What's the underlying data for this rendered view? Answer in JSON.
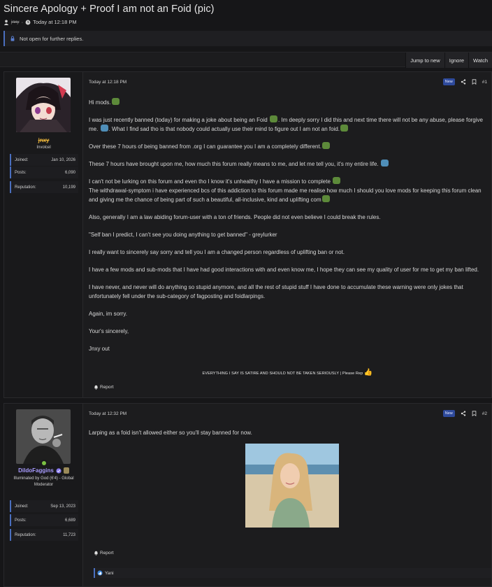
{
  "thread": {
    "title": "Sincere Apology + Proof I am not an Foid (pic)",
    "author": "jnxy",
    "date": "Today at 12:18 PM",
    "notice": "Not open for further replies."
  },
  "actions": {
    "jump_to_new": "Jump to new",
    "ignore": "Ignore",
    "watch": "Watch"
  },
  "posts": [
    {
      "username": "jnxy",
      "user_title": "Involcel",
      "joined_label": "Joined:",
      "joined": "Jan 10, 2026",
      "posts_label": "Posts:",
      "posts": "6,090",
      "reputation_label": "Reputation:",
      "reputation": "10,199",
      "date": "Today at 12:18 PM",
      "badge": "New",
      "number": "#1",
      "paragraphs": [
        "Hi mods.",
        "I was just recently banned (today) for making a joke about being an Foid",
        ". Im deeply sorry I did this and next time there will not be any abuse, please forgive me.",
        ". What I find sad tho is that nobody could actually use their mind to figure out I am not an foid.",
        "Over these 7 hours of being banned from .org I can guarantee you I am a completely different.",
        "These 7 hours have brought upon me, how much this forum really means to me, and let me tell you, it's my entire life.",
        "I can't not be lurking on this forum and even tho I know it's unhealthy I have a mission to complete",
        "The withdrawal-symptom i have experienced bcs of this addiction to this forum made me realise how much I should you love mods for keeping this forum clean and giving me the chance of being part of such a beautiful, all-inclusive, kind and uplifting com",
        "Also, generally I am a law abiding forum-user with a ton of friends. People did not even believe I could break the rules.",
        "\"Self ban I predict, I can't see you doing anything to get banned\" - greylurker",
        "I really want to sincerely say sorry and tell you I am a changed person regardless of uplifting ban or not.",
        "I have a few mods and sub-mods that I have had good interactions with and even know me, I hope they can see my quality of user for me to get my ban lifted.",
        "I have never, and never will do anything so stupid anymore, and all the rest of stupid stuff I have done to accumulate these warning were only jokes that unfortunately fell under the sub-category of fagposting and foidlarpings.",
        "Again, im sorry.",
        "Your's sincerely,",
        "Jnxy out"
      ],
      "signature": "EVERYTHING I SAY IS SATIRE AND SHOULD NOT BE TAKEN SERIOUSLY | Please Rep",
      "report": "Report"
    },
    {
      "username": "DildoFaggins",
      "user_title": "Illuminated by God (6'4) - Global Moderator",
      "joined_label": "Joined:",
      "joined": "Sep 13, 2023",
      "posts_label": "Posts:",
      "posts": "6,689",
      "reputation_label": "Reputation:",
      "reputation": "11,723",
      "date": "Today at 12:32 PM",
      "badge": "New",
      "number": "#2",
      "paragraphs": [
        "Larping as a foid isn't allowed either so you'll stay banned for now."
      ],
      "report": "Report",
      "reactions": "Yani"
    }
  ],
  "icons": [
    "user-icon",
    "clock-icon",
    "lock-icon",
    "share-icon",
    "bookmark-icon",
    "bell-icon",
    "like-icon",
    "verified-icon",
    "thumbs-up-icon"
  ],
  "colors": {
    "accent": "#4a6fbf",
    "new_badge": "#2e4a9c",
    "username1": "#e8b23a",
    "username2": "#a99cff",
    "online": "#7bc043"
  }
}
